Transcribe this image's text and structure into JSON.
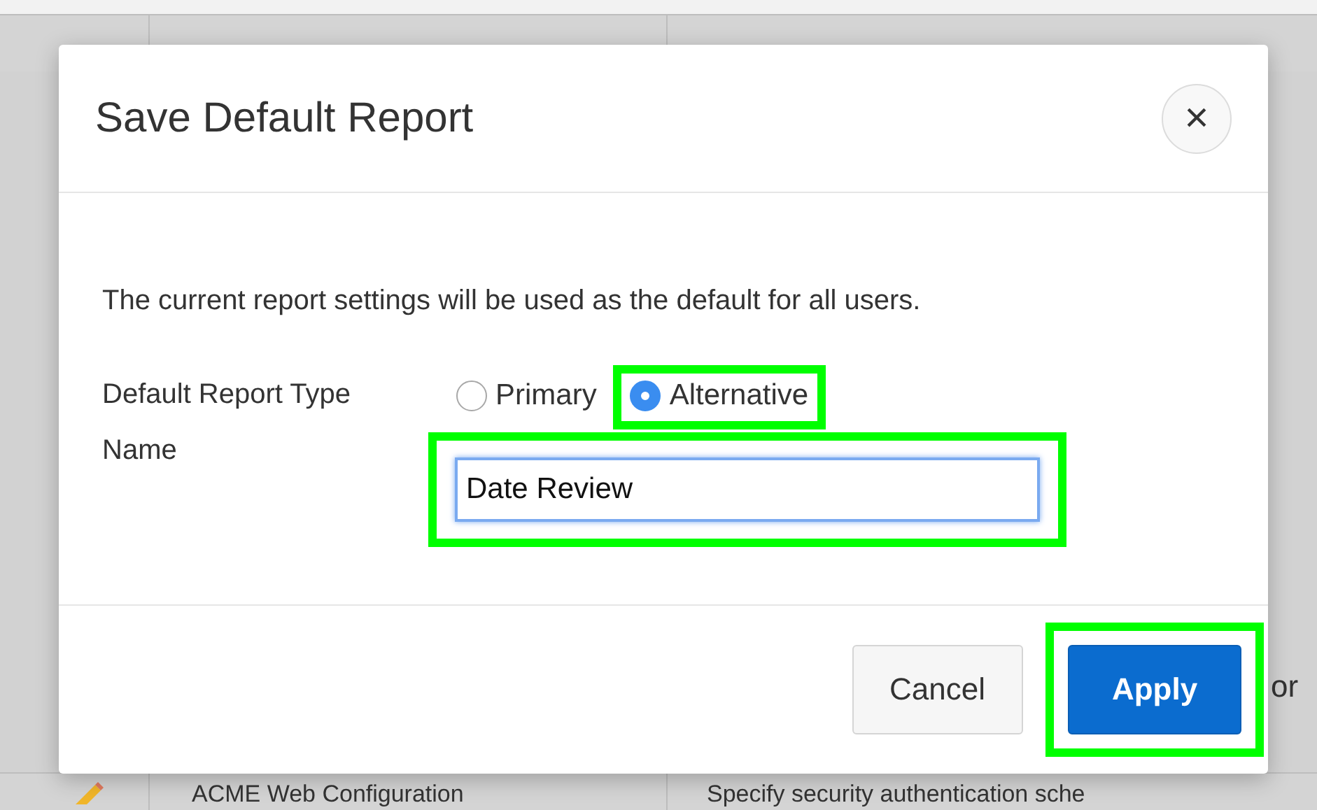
{
  "background": {
    "row_text": "ACME Web Configuration",
    "row_description": "Specify security authentication sche",
    "side_text": "or"
  },
  "dialog": {
    "title": "Save Default Report",
    "close": "×",
    "message": "The current report settings will be used as the default for all users.",
    "report_type": {
      "label": "Default Report Type",
      "options": [
        {
          "label": "Primary",
          "selected": false,
          "highlighted": false
        },
        {
          "label": "Alternative",
          "selected": true,
          "highlighted": true
        }
      ]
    },
    "name": {
      "label": "Name",
      "value": "Date Review",
      "highlighted": true
    },
    "buttons": [
      {
        "label": "Cancel",
        "kind": "secondary",
        "highlighted": false
      },
      {
        "label": "Apply",
        "kind": "primary",
        "highlighted": true
      }
    ]
  }
}
